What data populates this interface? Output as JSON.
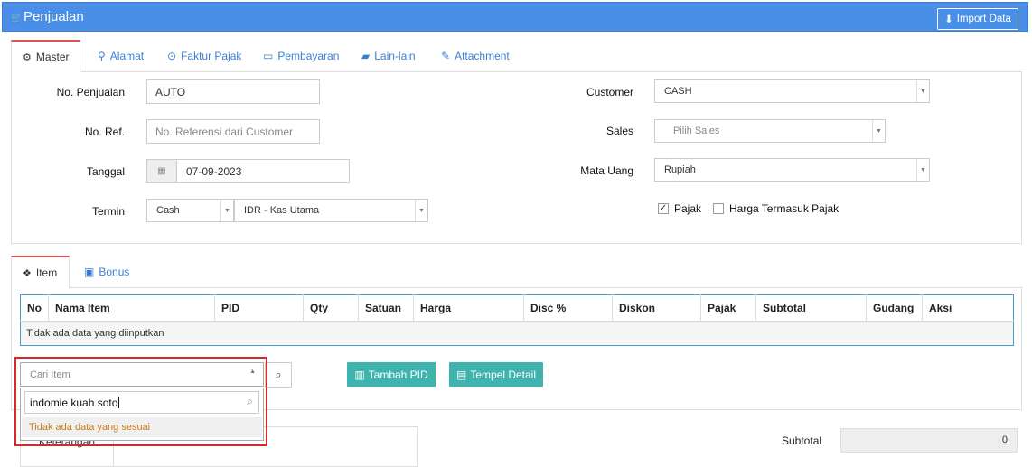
{
  "header": {
    "title": "Penjualan",
    "import_label": "Import Data"
  },
  "tabs": [
    "Master",
    "Alamat",
    "Faktur Pajak",
    "Pembayaran",
    "Lain-lain",
    "Attachment"
  ],
  "form": {
    "no_penjualan_label": "No. Penjualan",
    "no_penjualan_value": "AUTO",
    "no_ref_label": "No. Ref.",
    "no_ref_placeholder": "No. Referensi dari Customer",
    "tanggal_label": "Tanggal",
    "tanggal_value": "07-09-2023",
    "termin_label": "Termin",
    "termin_value": "Cash",
    "kas_value": "IDR - Kas Utama",
    "customer_label": "Customer",
    "customer_value": "CASH",
    "sales_label": "Sales",
    "sales_placeholder": "Pilih Sales",
    "mata_uang_label": "Mata Uang",
    "mata_uang_value": "Rupiah",
    "pajak_label": "Pajak",
    "pajak_checked": true,
    "harga_pajak_label": "Harga Termasuk Pajak",
    "harga_pajak_checked": false
  },
  "item_tabs": [
    "Item",
    "Bonus"
  ],
  "table": {
    "headers": [
      "No",
      "Nama Item",
      "PID",
      "Qty",
      "Satuan",
      "Harga",
      "Disc %",
      "Diskon",
      "Pajak",
      "Subtotal",
      "Gudang",
      "Aksi"
    ],
    "empty_text": "Tidak ada data yang diinputkan"
  },
  "search": {
    "select_placeholder": "Cari Item",
    "query": "indomie kuah soto",
    "no_result": "Tidak ada data yang sesuai"
  },
  "buttons": {
    "tambah_pid": "Tambah PID",
    "tempel_detail": "Tempel Detail"
  },
  "footer": {
    "keterangan_label": "Keterangan",
    "subtotal_label": "Subtotal",
    "subtotal_value": "0"
  },
  "colors": {
    "header": "#4a8fe7",
    "teal": "#3fb3ad",
    "highlight": "#d62828"
  }
}
